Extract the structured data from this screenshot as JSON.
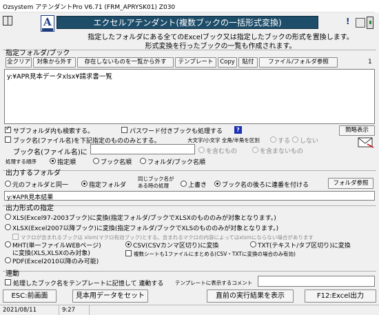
{
  "window": {
    "title": "Ozsystem アテンダントPro V6.71 (FRM_APRYSK01) Z030"
  },
  "header": {
    "banner": "エクセルアテンダント(複数ブックの一括形式変換)",
    "desc_line1": "指定したフォルダにある全てのExcelブック又は指定したブックの形式を置換します。",
    "desc_line2": "形式変換を行ったブックの一覧も作成されます。"
  },
  "folder_section": {
    "label": "指定フォルダ/ブック",
    "buttons": {
      "clear": "全クリア",
      "exclude": "対象から外す",
      "remove_missing": "存在しないものを一覧から外す",
      "template": "テンプレート",
      "copy": "Copy",
      "paste": "貼付",
      "browse": "ファイル/フォルダ参照"
    },
    "count": "1",
    "list_item": "y:¥APR見本データxlsx¥請求書一覧"
  },
  "options": {
    "subfolder": "サブフォルダ内も検索する。",
    "password": "パスワード付きブックも処理する",
    "help": "?",
    "simple_view": "簡略表示",
    "filter_by_name": "ブック名(ファイル名)を下記指定のもののみとする。",
    "case_label": "大文字/小文字 全角/半角を区別",
    "case_yes": "する",
    "case_no": "しない",
    "book_name_label": "ブック名(ファイル名)に",
    "contains": "を含むもの",
    "not_contains": "を含まないもの",
    "order_label": "処理する順序",
    "order_specified": "指定順",
    "order_bookname": "ブック名順",
    "order_folder_book": "フォルダ/ブック名順"
  },
  "output_folder": {
    "label": "出力するフォルダ",
    "same_as_source": "元のフォルダと同一",
    "specified": "指定フォルダ",
    "same_name_note_1": "同じブック名が",
    "same_name_note_2": "ある時の処理",
    "overwrite": "上書き",
    "append_serial": "ブック名の後ろに連番を付ける",
    "browse": "フォルダ参照",
    "path": "y:¥APR見本結果"
  },
  "format": {
    "label": "出力形式の指定",
    "xls": "XLS(Excel97-2003ブック)に変換(指定フォルダ/ブックでXLSXのもののみが対象となります。)",
    "xlsx": "XLSX(Excel2007以降ブック)に変換(指定フォルダ/ブックでXLSのもののみが対象となります。)",
    "macro_note": "マクロが含まれるブックは xlsm(マクロ有効ブック)とする。含まれるマクロの内容によってはxlsmにならない場合があります",
    "mht_1": "MHT(単一ファイルWEBページ)",
    "mht_2": "に変換(XLS,XLSXのみ対象)",
    "csv": "CSV(CSVカンマ区切り)に変換",
    "txt": "TXT(テキスト/タブ区切り)に変換",
    "multi_sheet": "複数シートも1ファイルにまとめる(CSV・TXTに変換の場合のみ有効)",
    "pdf": "PDF(Excel2010以降のみ可能)"
  },
  "link": {
    "label": "連動",
    "record_template": "処理したブック名をテンプレートに記憶して 連動する",
    "comment_label": "テンプレートに表示するコメント",
    "comment_value": ""
  },
  "footer": {
    "esc": "ESC:前画面",
    "sample": "見本用データをセット",
    "last_result": "直前の実行結果を表示",
    "f12": "F12:Excel出力"
  },
  "status": {
    "date": "2021/08/11",
    "time": "9:27"
  }
}
